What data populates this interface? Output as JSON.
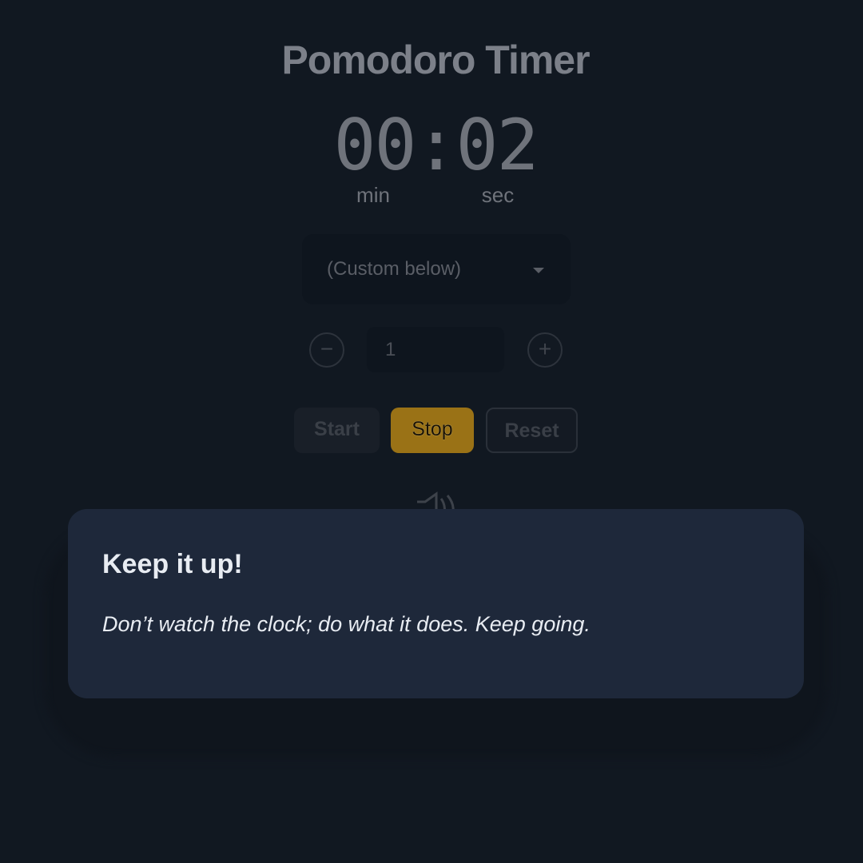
{
  "app": {
    "title": "Pomodoro Timer",
    "time_display": "00:02",
    "min_label": "min",
    "sec_label": "sec"
  },
  "preset": {
    "selected": "(Custom below)"
  },
  "stepper": {
    "minus_symbol": "−",
    "plus_symbol": "+",
    "value": "1"
  },
  "controls": {
    "start_label": "Start",
    "stop_label": "Stop",
    "reset_label": "Reset"
  },
  "sound": {
    "icon": "speaker-icon"
  },
  "toast": {
    "heading": "Keep it up!",
    "message": "Don’t watch the clock; do what it does. Keep going."
  },
  "colors": {
    "background": "#111821",
    "accent": "#9a7216",
    "toast_background": "#1e283a"
  }
}
